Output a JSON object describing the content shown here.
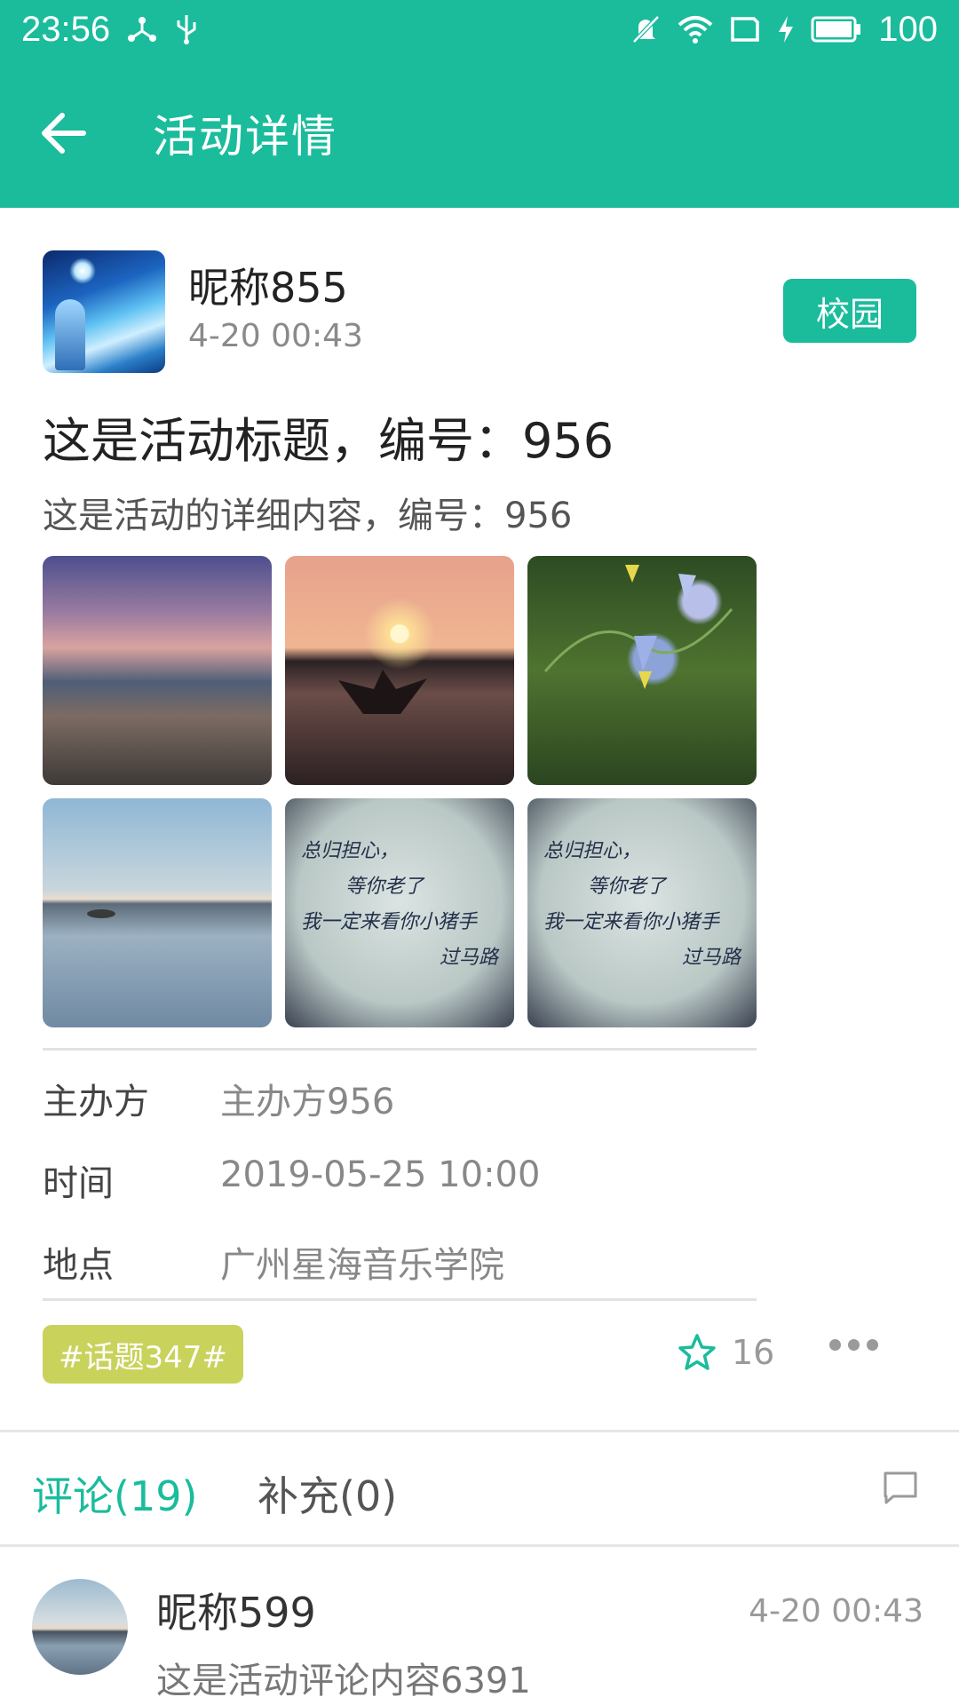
{
  "status_bar": {
    "time": "23:56",
    "battery": "100",
    "icons": [
      "network-icon",
      "usb-icon",
      "mute-icon",
      "wifi-icon",
      "sim-icon",
      "charging-icon",
      "battery-icon"
    ]
  },
  "app_bar": {
    "title": "活动详情",
    "back_icon": "arrow-left-icon",
    "background": "#1abc9c"
  },
  "author": {
    "name": "昵称855",
    "time": "4-20 00:43",
    "tag": "校园"
  },
  "activity": {
    "title": "这是活动标题，编号：956",
    "description": "这是活动的详细内容，编号：956",
    "images": [
      "station-photo",
      "paper-boat-sunset-photo",
      "flowers-photo",
      "lake-photo",
      "handwriting-photo",
      "handwriting-photo"
    ],
    "handwriting": [
      "总归担心，",
      "等你老了",
      "我一定来看你小猪手",
      "过马路"
    ]
  },
  "details": [
    {
      "label": "主办方",
      "value": "主办方956"
    },
    {
      "label": "时间",
      "value": "2019-05-25 10:00"
    },
    {
      "label": "地点",
      "value": "广州星海音乐学院"
    }
  ],
  "topic": "#话题347#",
  "favorites": "16",
  "tabs": {
    "comments": "评论(19)",
    "supplement": "补充(0)"
  },
  "comments": [
    {
      "name": "昵称599",
      "time": "4-20 00:43",
      "text": "这是活动评论内容6391"
    }
  ],
  "colors": {
    "accent": "#1abc9c",
    "topic_chip": "#c9d25b"
  }
}
